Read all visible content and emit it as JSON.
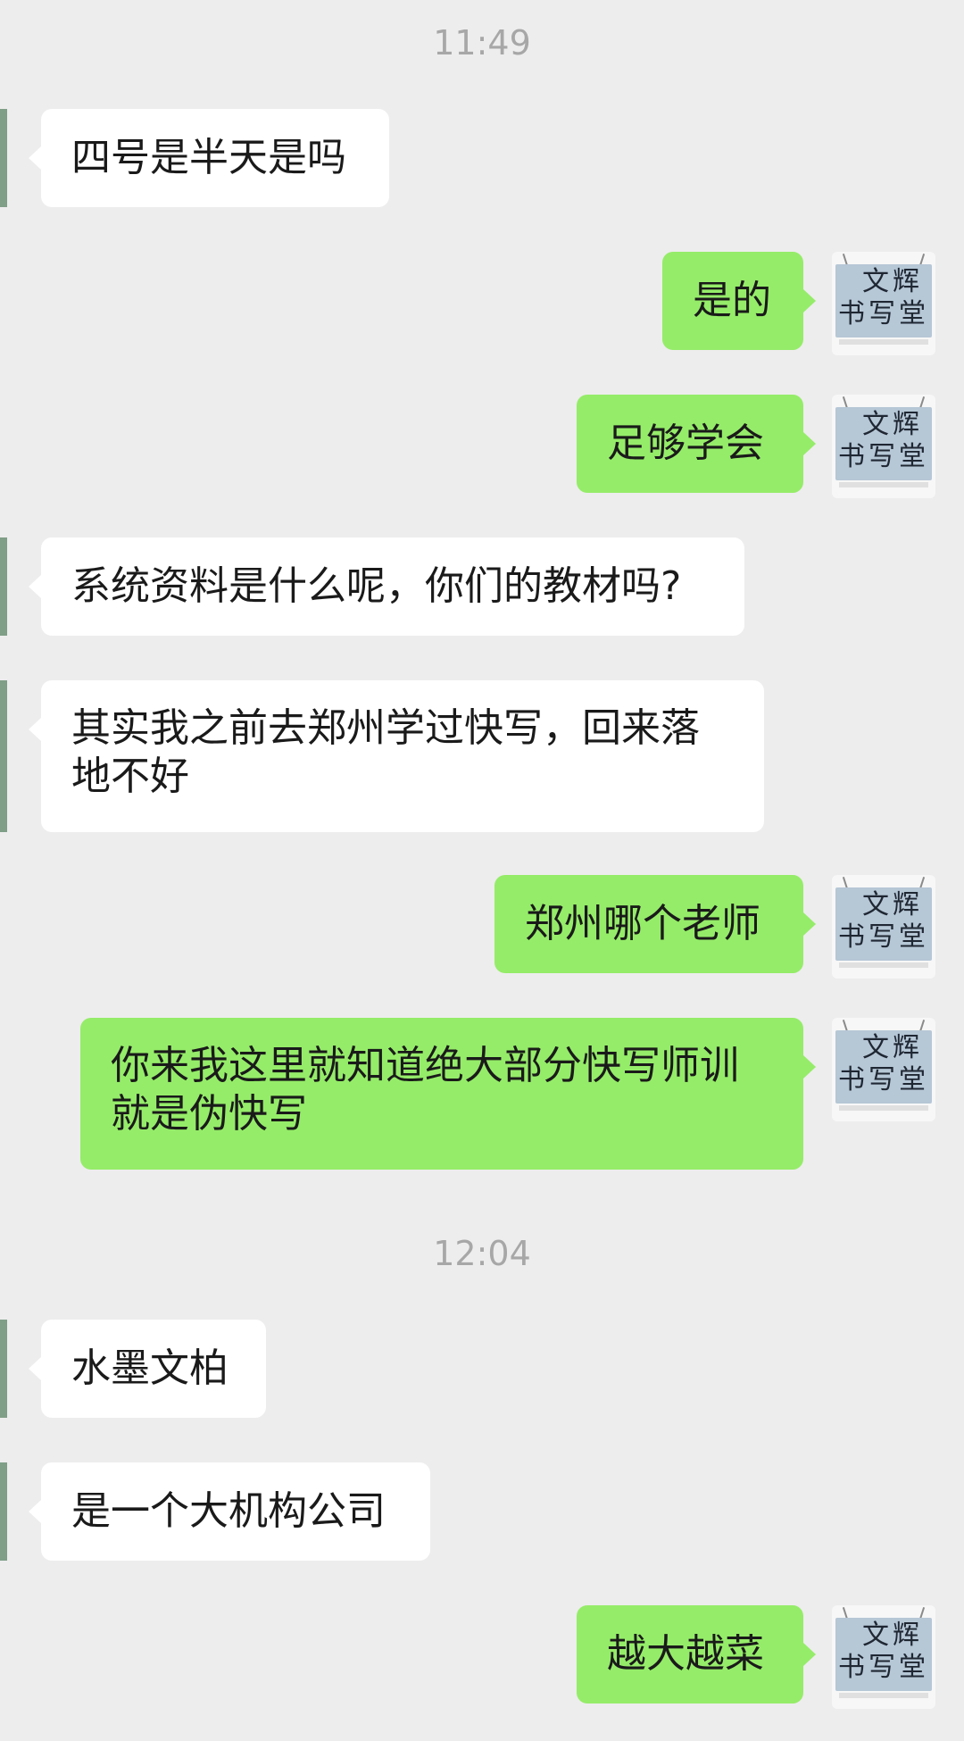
{
  "timestamps": {
    "top": "11:49",
    "middle": "12:04"
  },
  "messages": [
    {
      "direction": "incoming",
      "text": "四号是半天是吗"
    },
    {
      "direction": "outgoing",
      "text": "是的"
    },
    {
      "direction": "outgoing",
      "text": "足够学会"
    },
    {
      "direction": "incoming",
      "text": "系统资料是什么呢，你们的教材吗?"
    },
    {
      "direction": "incoming",
      "text": "其实我之前去郑州学过快写，回来落\n地不好"
    },
    {
      "direction": "outgoing",
      "text": "郑州哪个老师"
    },
    {
      "direction": "outgoing",
      "text": "你来我这里就知道绝大部分快写师训\n就是伪快写"
    },
    {
      "direction": "incoming",
      "text": "水墨文柏"
    },
    {
      "direction": "incoming",
      "text": "是一个大机构公司"
    },
    {
      "direction": "outgoing",
      "text": "越大越菜"
    }
  ],
  "avatar": {
    "line1": "文辉",
    "line2": "书写堂"
  },
  "colors": {
    "background": "#ededed",
    "incoming_bubble": "#ffffff",
    "outgoing_bubble": "#95ec69",
    "timestamp_text": "#a7a7a7"
  }
}
